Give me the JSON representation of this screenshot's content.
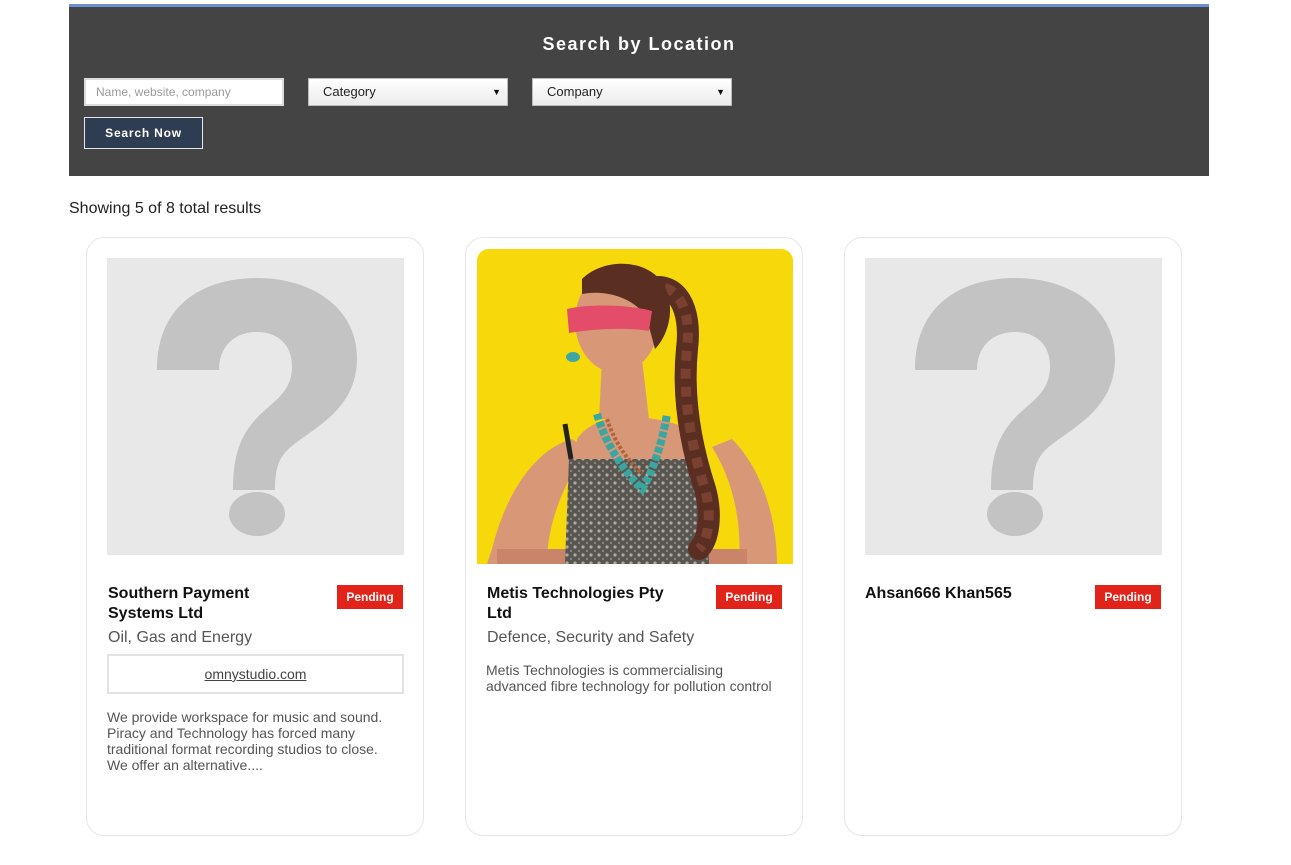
{
  "search": {
    "title": "Search by Location",
    "input_placeholder": "Name, website, company",
    "category_selected": "Category",
    "company_selected": "Company",
    "button_label": "Search Now"
  },
  "results": {
    "summary": "Showing 5 of 8 total results"
  },
  "cards": [
    {
      "title": "Southern Payment Systems Ltd",
      "status": "Pending",
      "category": "Oil, Gas and Energy",
      "website": "omnystudio.com",
      "description": "We provide workspace for music and sound. Piracy and Technology has forced many traditional format recording studios to close. We offer an alternative....",
      "image": "placeholder-question-mark"
    },
    {
      "title": "Metis Technologies Pty Ltd",
      "status": "Pending",
      "category": "Defence, Security and Safety",
      "description": "Metis Technologies is commercialising advanced fibre technology for pollution control",
      "image": "photo-woman-yellow-background"
    },
    {
      "title": "Ahsan666 Khan565",
      "status": "Pending",
      "image": "placeholder-question-mark"
    }
  ],
  "colors": {
    "panel_bg": "#444444",
    "panel_top_border": "#6b8fd4",
    "button_bg": "#2e3d52",
    "badge_red": "#e2231a",
    "photo_bg": "#f7d90b"
  }
}
